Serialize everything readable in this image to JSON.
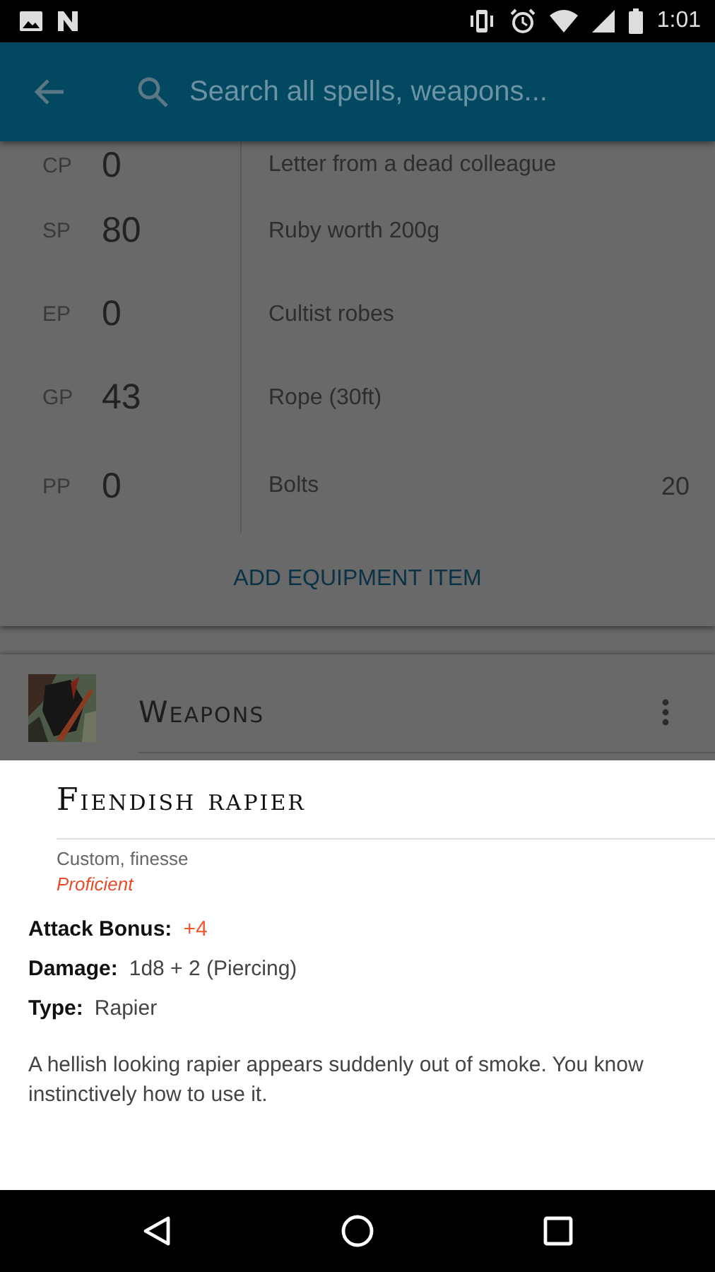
{
  "status_bar": {
    "time": "1:01"
  },
  "app_bar": {
    "search": {
      "placeholder": "Search all spells, weapons..."
    }
  },
  "currency": [
    {
      "label": "CP",
      "amount": "0"
    },
    {
      "label": "SP",
      "amount": "80"
    },
    {
      "label": "EP",
      "amount": "0"
    },
    {
      "label": "GP",
      "amount": "43"
    },
    {
      "label": "PP",
      "amount": "0"
    }
  ],
  "equipment": [
    {
      "name": "Letter from a dead colleague"
    },
    {
      "name": "Ruby worth 200g"
    },
    {
      "name": "Cultist robes"
    },
    {
      "name": "Rope (30ft)"
    },
    {
      "name": "Bolts",
      "count": "20"
    }
  ],
  "add_button": "ADD EQUIPMENT ITEM",
  "section": {
    "title": "Weapons"
  },
  "sheet": {
    "title": "Fiendish rapier",
    "subtitle": "Custom, finesse",
    "proficient": true,
    "proficiency_label": "Proficient",
    "fields": [
      {
        "label": "Attack Bonus:",
        "value": "+4",
        "highlight": true
      },
      {
        "label": "Damage:",
        "value": "1d8 + 2 (Piercing)",
        "highlight": false
      },
      {
        "label": "Type:",
        "value": "Rapier",
        "highlight": false
      }
    ],
    "description": "A hellish looking rapier appears suddenly out of smoke. You know instinctively how to use it."
  }
}
